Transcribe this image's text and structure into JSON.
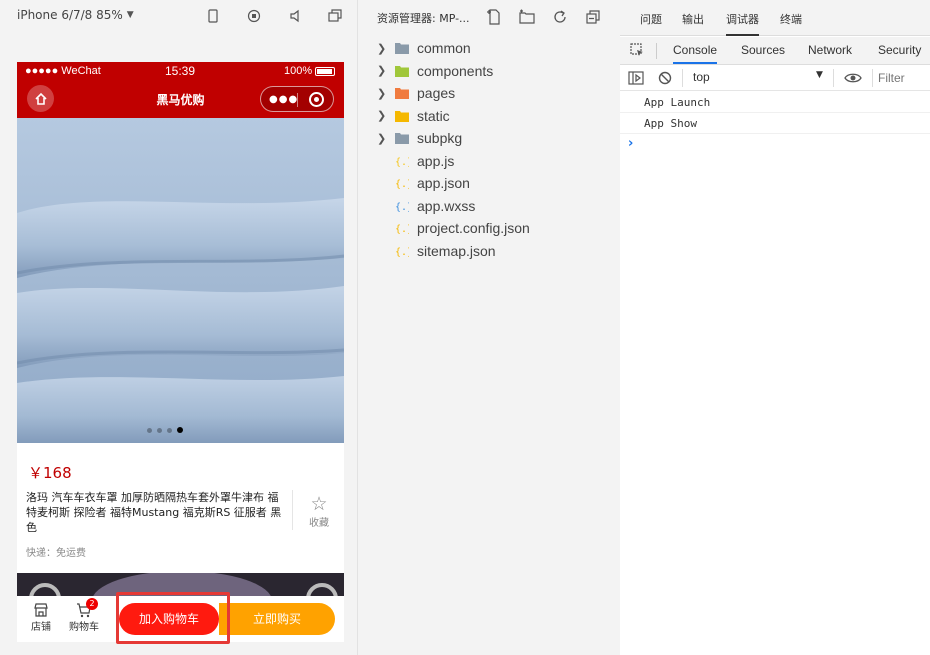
{
  "simulator": {
    "device_label": "iPhone 6/7/8 85%",
    "status": {
      "carrier": "●●●●● WeChat",
      "time": "15:39",
      "battery": "100%"
    },
    "nav_title": "黑马优购",
    "swiper_dots": 4,
    "swiper_active_index": 3,
    "price": "￥168",
    "goods_name": "洛玛 汽车车衣车罩 加厚防晒隔热车套外罩牛津布 福特麦柯斯 探险者 福特Mustang 福克斯RS 征服者 黑色",
    "fav_label": "收藏",
    "shipping": "快递：免运费",
    "bottom": {
      "shop_label": "店铺",
      "cart_label": "购物车",
      "cart_badge": "2",
      "add_cart_label": "加入购物车",
      "buy_label": "立即购买"
    }
  },
  "explorer": {
    "title": "资源管理器: MP-...",
    "items": [
      {
        "name": "common",
        "type": "folder",
        "icon_color": "#8a9aa9"
      },
      {
        "name": "components",
        "type": "folder",
        "icon_color": "#a0c73a"
      },
      {
        "name": "pages",
        "type": "folder",
        "icon_color": "#f07b3f"
      },
      {
        "name": "static",
        "type": "folder",
        "icon_color": "#f5b800"
      },
      {
        "name": "subpkg",
        "type": "folder",
        "icon_color": "#8a9aa9"
      },
      {
        "name": "app.js",
        "type": "file",
        "icon_color": "#f5c518"
      },
      {
        "name": "app.json",
        "type": "file",
        "icon_color": "#f5b800"
      },
      {
        "name": "app.wxss",
        "type": "file",
        "icon_color": "#3b8ede"
      },
      {
        "name": "project.config.json",
        "type": "file",
        "icon_color": "#f5b800"
      },
      {
        "name": "sitemap.json",
        "type": "file",
        "icon_color": "#f5b800"
      }
    ]
  },
  "devtools": {
    "top_tabs": [
      "问题",
      "输出",
      "调试器",
      "终端"
    ],
    "active_top_tab": "调试器",
    "sub_tabs": [
      "Console",
      "Sources",
      "Network",
      "Security"
    ],
    "active_sub_tab": "Console",
    "context": "top",
    "filter_placeholder": "Filter",
    "console_lines": [
      "App Launch",
      "App Show"
    ],
    "prompt": "›"
  },
  "colors": {
    "nav_red": "#c00000",
    "add_cart_red": "#ff1a0f",
    "buy_orange": "#ffa200",
    "highlight": "#e53935"
  }
}
